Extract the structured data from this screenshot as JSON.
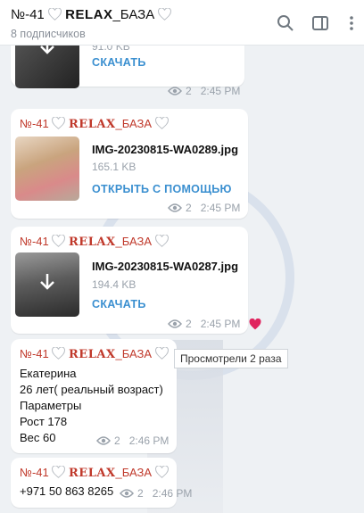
{
  "header": {
    "title_prefix": "№-41",
    "title_brand": "RELAX",
    "title_suffix": "_БАЗА",
    "subscribers": "8 подписчиков"
  },
  "messages": [
    {
      "file_size": "91.0 KB",
      "action": "СКАЧАТЬ",
      "views": "2",
      "time": "2:45 PM"
    },
    {
      "sender_prefix": "№-41",
      "sender_brand": "RELAX",
      "sender_suffix": "_БАЗА",
      "file_name": "IMG-20230815-WA0289.jpg",
      "file_size": "165.1 KB",
      "action": "ОТКРЫТЬ С ПОМОЩЬЮ",
      "views": "2",
      "time": "2:45 PM"
    },
    {
      "sender_prefix": "№-41",
      "sender_brand": "RELAX",
      "sender_suffix": "_БАЗА",
      "file_name": "IMG-20230815-WA0287.jpg",
      "file_size": "194.4 KB",
      "action": "СКАЧАТЬ",
      "views": "2",
      "time": "2:45 PM",
      "reaction": "red-heart-icon"
    },
    {
      "sender_prefix": "№-41",
      "sender_brand": "RELAX",
      "sender_suffix": "_БАЗА",
      "lines": [
        "Екатерина",
        "26 лет( реальный возраст)",
        "Параметры",
        "Рост 178",
        "Вес 60"
      ],
      "views": "2",
      "time": "2:46 PM"
    },
    {
      "sender_prefix": "№-41",
      "sender_brand": "RELAX",
      "sender_suffix": "_БАЗА",
      "phone": "+971 50 863 8265",
      "views": "2",
      "time": "2:46 PM"
    }
  ],
  "tooltip": "Просмотрели 2 раза",
  "colors": {
    "sender": "#c0392b",
    "link": "#3a8fd0",
    "meta": "#9aa2ab",
    "reaction": "#e0245e"
  }
}
